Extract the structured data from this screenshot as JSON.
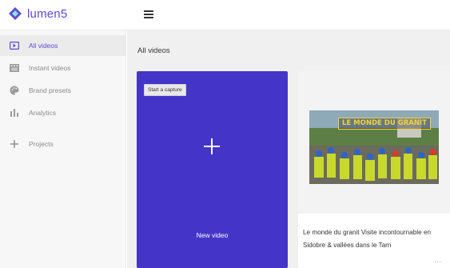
{
  "app": {
    "brand": "lumen5"
  },
  "sidebar": {
    "items": [
      {
        "label": "All videos",
        "icon": "play-square-icon"
      },
      {
        "label": "Instant videos",
        "icon": "film-icon"
      },
      {
        "label": "Brand presets",
        "icon": "palette-icon"
      },
      {
        "label": "Analytics",
        "icon": "bar-chart-icon"
      },
      {
        "label": "Projects",
        "icon": "plus-icon"
      }
    ]
  },
  "main": {
    "title": "All videos",
    "new_card": {
      "tag": "Start a capture",
      "label": "New video"
    },
    "video": {
      "thumb_title": "LE MONDE DU GRANIT",
      "title": "Le monde du granit Visite incontournable en Sidobre & vallées dans le Tarn",
      "more": "..."
    }
  },
  "colors": {
    "accent": "#5b4bd6",
    "new_card": "#4435c8",
    "thumb_text": "#f2d23a"
  }
}
